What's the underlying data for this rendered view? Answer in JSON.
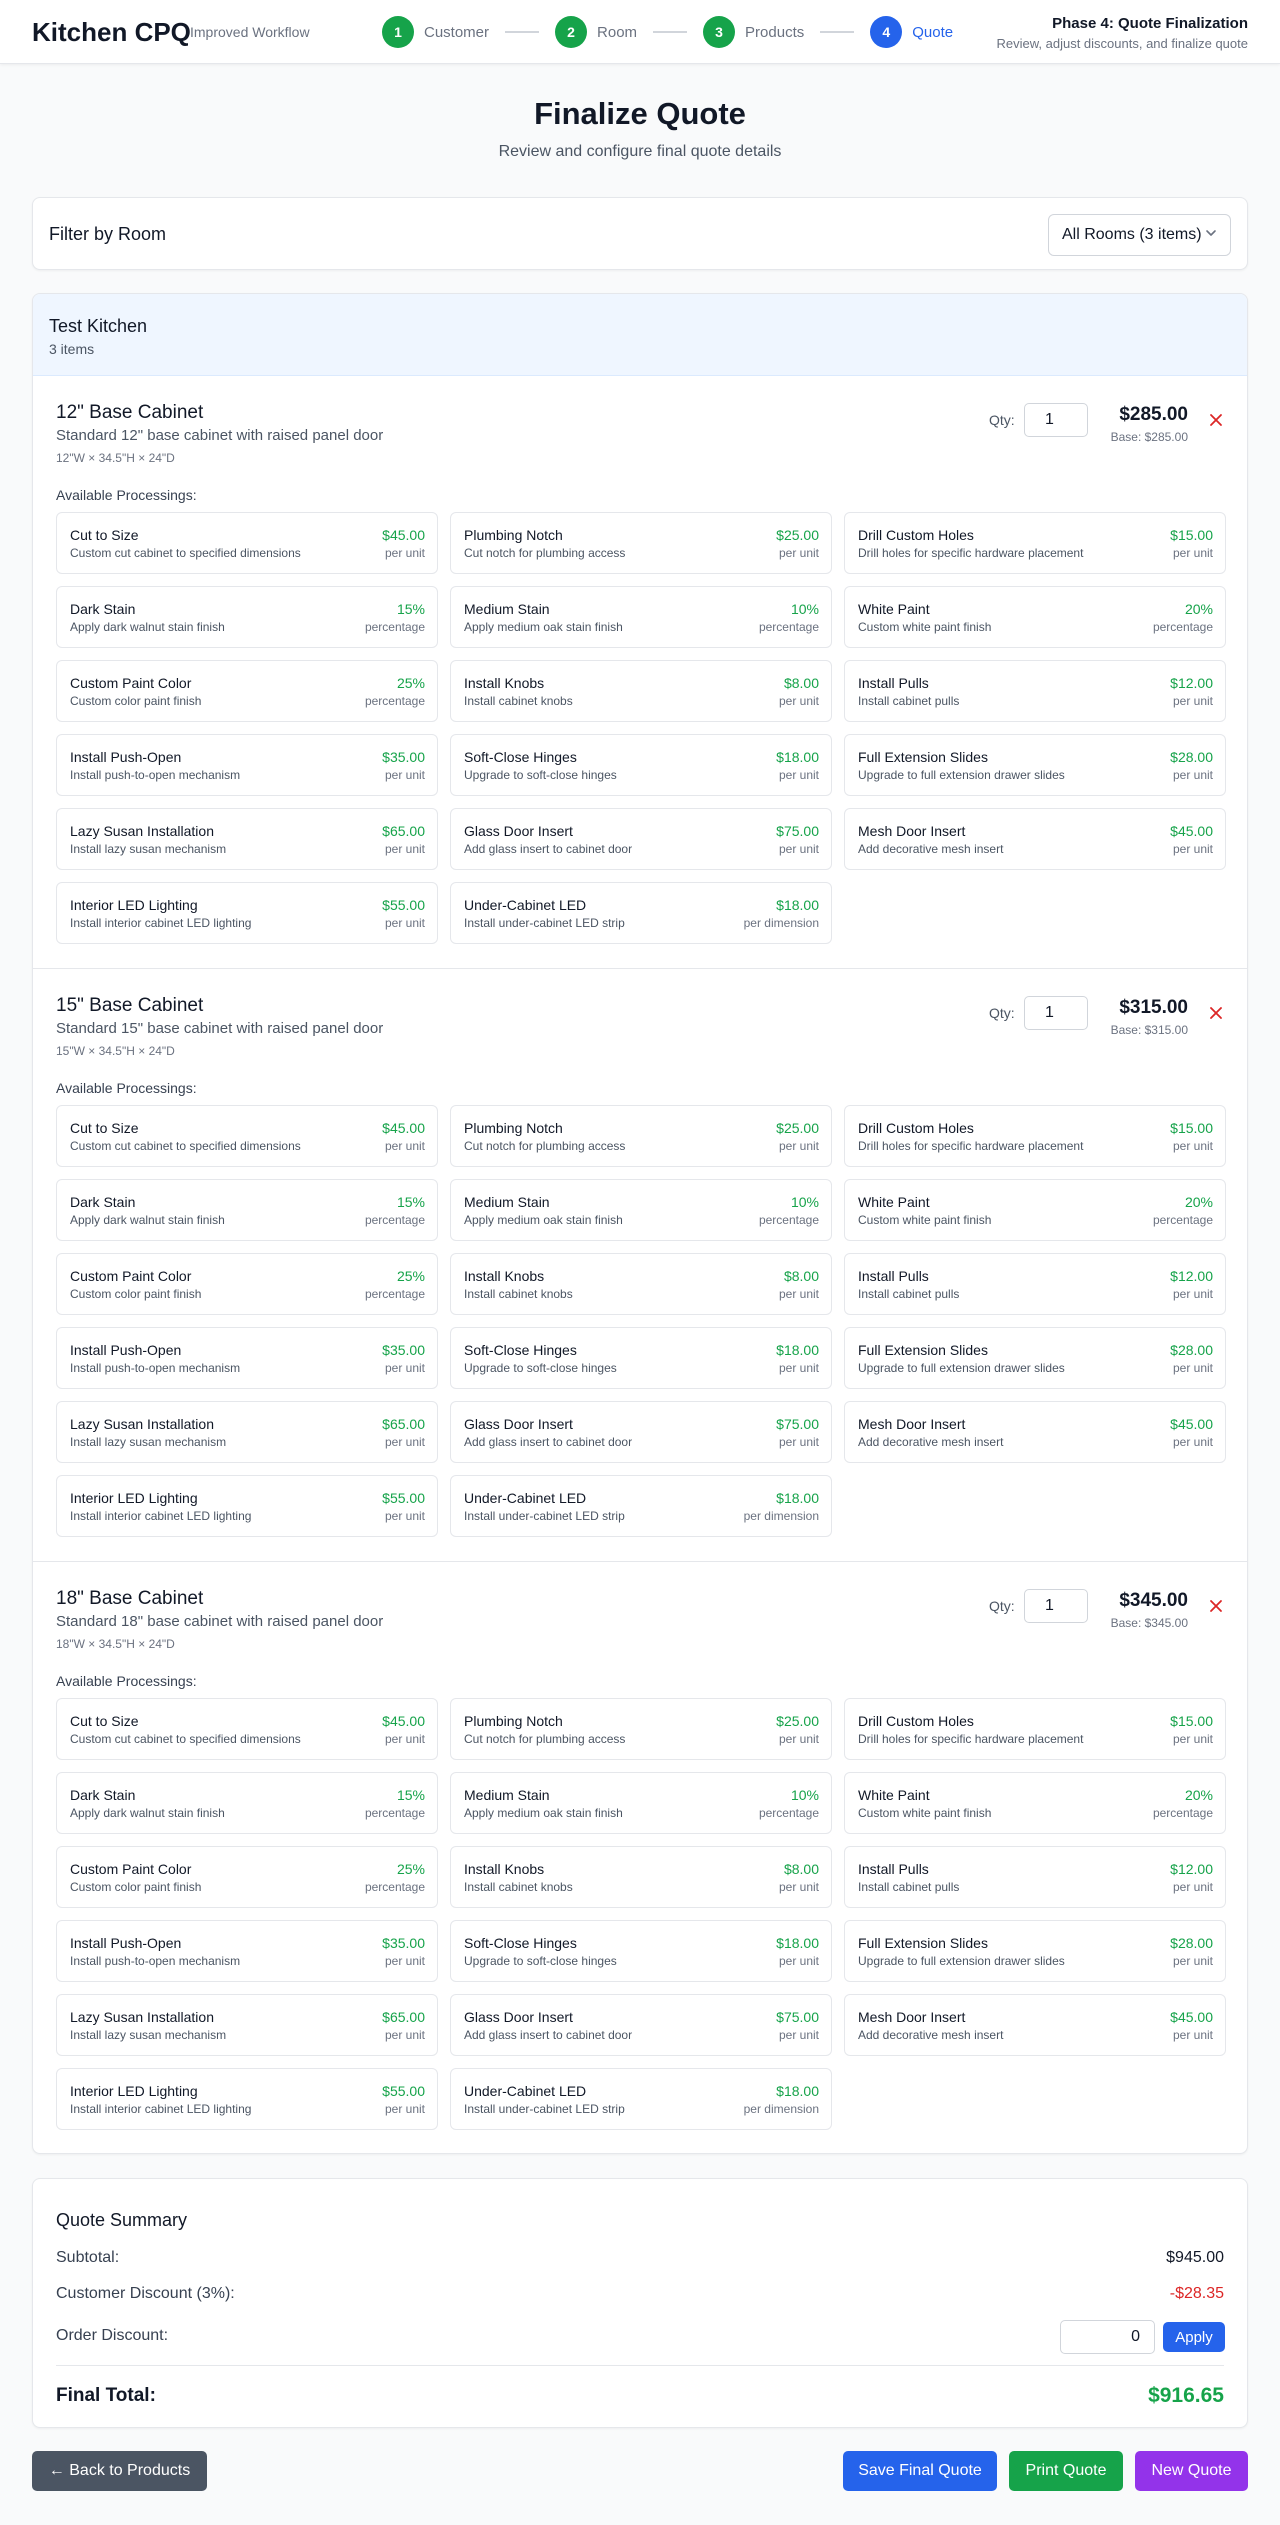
{
  "header": {
    "brand": "Kitchen CPQ",
    "subtitle": "Improved Workflow",
    "steps": [
      {
        "number": "1",
        "label": "Customer",
        "status": "done"
      },
      {
        "number": "2",
        "label": "Room",
        "status": "done"
      },
      {
        "number": "3",
        "label": "Products",
        "status": "done"
      },
      {
        "number": "4",
        "label": "Quote",
        "status": "active"
      }
    ],
    "phase_title": "Phase 4: Quote Finalization",
    "phase_subtitle": "Review, adjust discounts, and finalize quote"
  },
  "page": {
    "title": "Finalize Quote",
    "subtitle": "Review and configure final quote details"
  },
  "filter": {
    "title": "Filter by Room",
    "selected": "All Rooms (3 items)"
  },
  "room": {
    "name": "Test Kitchen",
    "count": "3 items",
    "products": [
      {
        "name": "12\" Base Cabinet",
        "description": "Standard 12\" base cabinet with raised panel door",
        "dimensions": "12\"W × 34.5\"H × 24\"D",
        "qty_label": "Qty:",
        "qty": "1",
        "price": "$285.00",
        "base": "Base: $285.00",
        "available_label": "Available Processings:"
      },
      {
        "name": "15\" Base Cabinet",
        "description": "Standard 15\" base cabinet with raised panel door",
        "dimensions": "15\"W × 34.5\"H × 24\"D",
        "qty_label": "Qty:",
        "qty": "1",
        "price": "$315.00",
        "base": "Base: $315.00",
        "available_label": "Available Processings:"
      },
      {
        "name": "18\" Base Cabinet",
        "description": "Standard 18\" base cabinet with raised panel door",
        "dimensions": "18\"W × 34.5\"H × 24\"D",
        "qty_label": "Qty:",
        "qty": "1",
        "price": "$345.00",
        "base": "Base: $345.00",
        "available_label": "Available Processings:"
      }
    ],
    "processings": [
      {
        "name": "Cut to Size",
        "desc": "Custom cut cabinet to specified dimensions",
        "price": "$45.00",
        "unit": "per unit"
      },
      {
        "name": "Plumbing Notch",
        "desc": "Cut notch for plumbing access",
        "price": "$25.00",
        "unit": "per unit"
      },
      {
        "name": "Drill Custom Holes",
        "desc": "Drill holes for specific hardware placement",
        "price": "$15.00",
        "unit": "per unit"
      },
      {
        "name": "Dark Stain",
        "desc": "Apply dark walnut stain finish",
        "price": "15%",
        "unit": "percentage"
      },
      {
        "name": "Medium Stain",
        "desc": "Apply medium oak stain finish",
        "price": "10%",
        "unit": "percentage"
      },
      {
        "name": "White Paint",
        "desc": "Custom white paint finish",
        "price": "20%",
        "unit": "percentage"
      },
      {
        "name": "Custom Paint Color",
        "desc": "Custom color paint finish",
        "price": "25%",
        "unit": "percentage"
      },
      {
        "name": "Install Knobs",
        "desc": "Install cabinet knobs",
        "price": "$8.00",
        "unit": "per unit"
      },
      {
        "name": "Install Pulls",
        "desc": "Install cabinet pulls",
        "price": "$12.00",
        "unit": "per unit"
      },
      {
        "name": "Install Push-Open",
        "desc": "Install push-to-open mechanism",
        "price": "$35.00",
        "unit": "per unit"
      },
      {
        "name": "Soft-Close Hinges",
        "desc": "Upgrade to soft-close hinges",
        "price": "$18.00",
        "unit": "per unit"
      },
      {
        "name": "Full Extension Slides",
        "desc": "Upgrade to full extension drawer slides",
        "price": "$28.00",
        "unit": "per unit"
      },
      {
        "name": "Lazy Susan Installation",
        "desc": "Install lazy susan mechanism",
        "price": "$65.00",
        "unit": "per unit"
      },
      {
        "name": "Glass Door Insert",
        "desc": "Add glass insert to cabinet door",
        "price": "$75.00",
        "unit": "per unit"
      },
      {
        "name": "Mesh Door Insert",
        "desc": "Add decorative mesh insert",
        "price": "$45.00",
        "unit": "per unit"
      },
      {
        "name": "Interior LED Lighting",
        "desc": "Install interior cabinet LED lighting",
        "price": "$55.00",
        "unit": "per unit"
      },
      {
        "name": "Under-Cabinet LED",
        "desc": "Install under-cabinet LED strip",
        "price": "$18.00",
        "unit": "per dimension"
      }
    ]
  },
  "summary": {
    "title": "Quote Summary",
    "subtotal_label": "Subtotal:",
    "subtotal": "$945.00",
    "customer_discount_label": "Customer Discount (3%):",
    "customer_discount": "-$28.35",
    "order_discount_label": "Order Discount:",
    "order_discount_value": "0",
    "apply_label": "Apply",
    "final_total_label": "Final Total:",
    "final_total": "$916.65"
  },
  "actions": {
    "back": "← Back to Products",
    "save": "Save Final Quote",
    "print": "Print Quote",
    "new": "New Quote"
  },
  "colors": {
    "done": "#16a34a",
    "active": "#2563eb",
    "price_green": "#16a34a",
    "discount_red": "#dc2626"
  },
  "icons": {
    "filter_chevron": "chevron-down-icon",
    "remove": "close-icon"
  }
}
